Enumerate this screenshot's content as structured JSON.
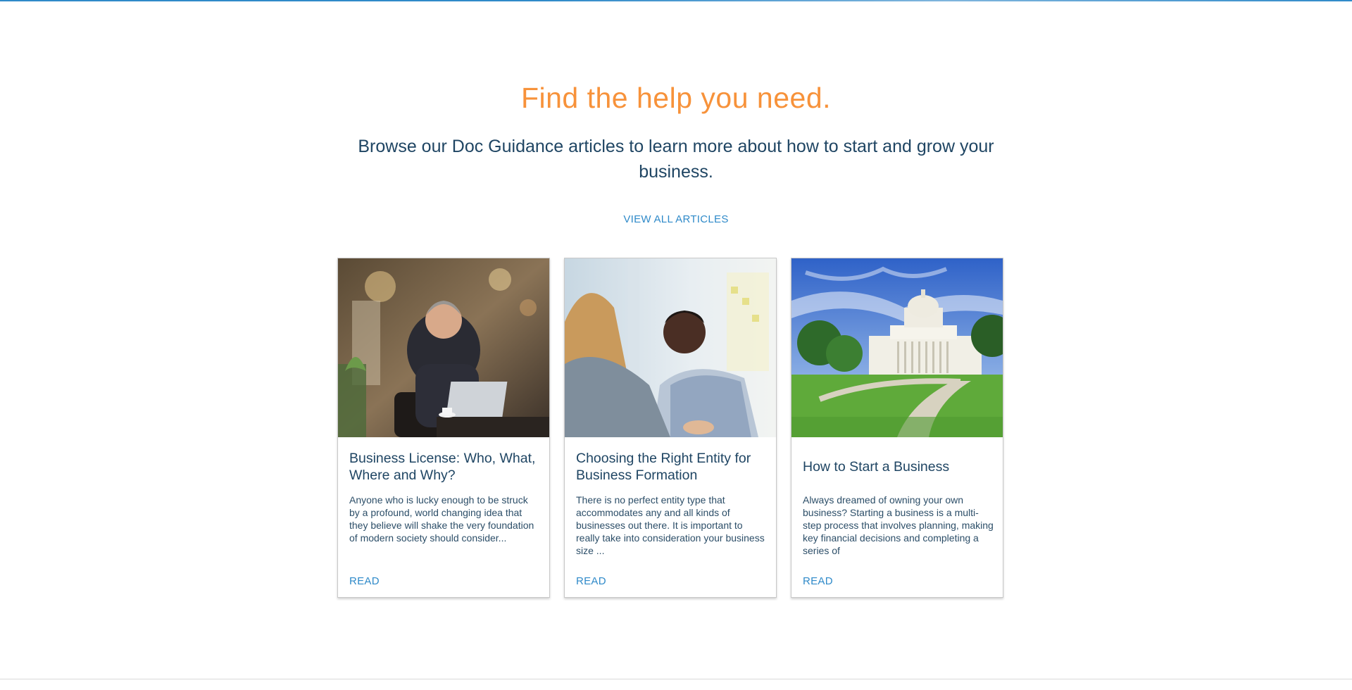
{
  "page": {
    "headline": "Find the help you need.",
    "subhead": "Browse our Doc Guidance articles to learn more about how to start and grow your business.",
    "view_all_label": "VIEW ALL ARTICLES"
  },
  "articles": [
    {
      "title": "Business License: Who, What, Where and Why?",
      "excerpt": "Anyone who is lucky enough to be struck by a profound, world changing idea that they believe will shake the very foundation of modern society should consider...",
      "read_label": "READ",
      "image": "businessman-at-laptop-in-cafe"
    },
    {
      "title": "Choosing the Right Entity for Business Formation",
      "excerpt": "There is no perfect entity type that accommodates any and all kinds of businesses out there. It is important to really take into consideration your business size ...",
      "read_label": "READ",
      "image": "business-meeting-conversation"
    },
    {
      "title": "How to Start a Business",
      "excerpt": "Always dreamed of owning your own business? Starting a business is a multi-step process that involves planning, making key financial decisions and completing a series of",
      "read_label": "READ",
      "image": "state-capitol-building"
    }
  ],
  "colors": {
    "accent_orange": "#f7923a",
    "navy_text": "#1f4563",
    "link_blue": "#2f8ac9"
  }
}
